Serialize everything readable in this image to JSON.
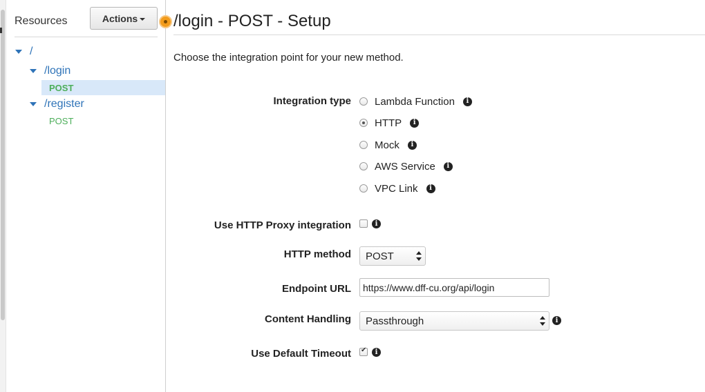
{
  "sidebar": {
    "title": "Resources",
    "actions_label": "Actions",
    "tree": {
      "root": "/",
      "login": "/login",
      "login_method": "POST",
      "register": "/register",
      "register_method": "POST"
    }
  },
  "main": {
    "title": "/login - POST - Setup",
    "intro": "Choose the integration point for your new method.",
    "integration_type": {
      "label": "Integration type",
      "options": [
        "Lambda Function",
        "HTTP",
        "Mock",
        "AWS Service",
        "VPC Link"
      ],
      "selected": "HTTP"
    },
    "proxy": {
      "label": "Use HTTP Proxy integration",
      "checked": false
    },
    "http_method": {
      "label": "HTTP method",
      "value": "POST"
    },
    "endpoint_url": {
      "label": "Endpoint URL",
      "value": "https://www.dff-cu.org/api/login"
    },
    "content_handling": {
      "label": "Content Handling",
      "value": "Passthrough"
    },
    "default_timeout": {
      "label": "Use Default Timeout",
      "checked": true
    }
  },
  "colors": {
    "link_blue": "#2e73b8",
    "method_green": "#4cae5a",
    "selected_bg": "#d8e8f9",
    "status_orange": "#f39c1c"
  },
  "icons": [
    "info-icon",
    "status-dot-icon",
    "collapse-triangle-icon",
    "caret-down-icon",
    "select-arrows-icon"
  ]
}
